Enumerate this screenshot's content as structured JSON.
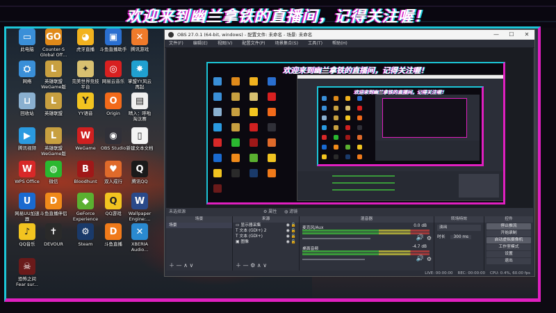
{
  "banner": {
    "text": "欢迎来到幽兰拿铁的直播间，记得关注喔！",
    "colors": {
      "magenta": "#e01fc0",
      "cyan": "#1cc6d8"
    }
  },
  "desktop": {
    "icons": [
      {
        "label": "此电脑",
        "icon": "computer-icon",
        "color": "#3a8fd8",
        "glyph": "▭"
      },
      {
        "label": "Counter-S\nGlobal Off...",
        "icon": "csgo-icon",
        "color": "#e08a1a",
        "glyph": "GO"
      },
      {
        "label": "虎牙直播",
        "icon": "huya-icon",
        "color": "#f2b21e",
        "glyph": "◕"
      },
      {
        "label": "斗鱼直播助手",
        "icon": "douyu-assistant-icon",
        "color": "#2a6fd0",
        "glyph": "▣"
      },
      {
        "label": "腾讯游戏",
        "icon": "tencent-game-icon",
        "color": "#f07a2a",
        "glyph": "✕"
      },
      {
        "label": "网络",
        "icon": "network-icon",
        "color": "#3a8fd8",
        "glyph": "⛭"
      },
      {
        "label": "英雄联盟\nWeGame版",
        "icon": "lol-icon",
        "color": "#c8a040",
        "glyph": "L"
      },
      {
        "label": "完美世界竞技\n平台",
        "icon": "perfect-world-icon",
        "color": "#d8c070",
        "glyph": "✦"
      },
      {
        "label": "网易云音乐",
        "icon": "netease-music-icon",
        "color": "#d82020",
        "glyph": "◎"
      },
      {
        "label": "掌盟YY风云\n再起",
        "icon": "yy-icon",
        "color": "#20a0d0",
        "glyph": "✸"
      },
      {
        "label": "回收站",
        "icon": "recycle-bin-icon",
        "color": "#8ab0d0",
        "glyph": "⊔"
      },
      {
        "label": "英雄联盟",
        "icon": "lol-icon",
        "color": "#c8a040",
        "glyph": "L"
      },
      {
        "label": "YY语音",
        "icon": "yy-voice-icon",
        "color": "#f2c420",
        "glyph": "Y"
      },
      {
        "label": "Origin",
        "icon": "origin-icon",
        "color": "#f26a1a",
        "glyph": "O"
      },
      {
        "label": "晴入：呼啦\n淘汰赛",
        "icon": "game-icon",
        "color": "#f0f0f0",
        "glyph": "▤"
      },
      {
        "label": "腾讯视频",
        "icon": "tencent-video-icon",
        "color": "#2a9ae0",
        "glyph": "▶"
      },
      {
        "label": "英雄联盟\nWeGame版",
        "icon": "lol-icon",
        "color": "#c8a040",
        "glyph": "L"
      },
      {
        "label": "WeGame",
        "icon": "wegame-icon",
        "color": "#d02020",
        "glyph": "W"
      },
      {
        "label": "OBS Studio",
        "icon": "obs-icon",
        "color": "#303038",
        "glyph": "◉"
      },
      {
        "label": "新建文本文档",
        "icon": "text-document-icon",
        "color": "#f4f4f4",
        "glyph": "▯"
      },
      {
        "label": "WPS Office",
        "icon": "wps-icon",
        "color": "#d82828",
        "glyph": "W"
      },
      {
        "label": "微信",
        "icon": "wechat-icon",
        "color": "#2ab830",
        "glyph": "◍"
      },
      {
        "label": "Bloodhunt",
        "icon": "bloodhunt-icon",
        "color": "#a01818",
        "glyph": "B"
      },
      {
        "label": "双人成行",
        "icon": "it-takes-two-icon",
        "color": "#e06a2a",
        "glyph": "♥"
      },
      {
        "label": "腾讯QQ",
        "icon": "qq-icon",
        "color": "#1a1a1a",
        "glyph": "Q"
      },
      {
        "label": "网易UU加速\n器",
        "icon": "uu-icon",
        "color": "#1a6ad0",
        "glyph": "U"
      },
      {
        "label": "斗鱼直播伴侣",
        "icon": "douyu-companion-icon",
        "color": "#f08a1a",
        "glyph": "D"
      },
      {
        "label": "GeForce\nExperience",
        "icon": "geforce-icon",
        "color": "#5ab030",
        "glyph": "◆"
      },
      {
        "label": "QQ游戏",
        "icon": "qq-game-icon",
        "color": "#f2c420",
        "glyph": "Q"
      },
      {
        "label": "Wallpaper\nEngine:...",
        "icon": "wallpaper-engine-icon",
        "color": "#2a4a8a",
        "glyph": "W"
      },
      {
        "label": "QQ音乐",
        "icon": "qq-music-icon",
        "color": "#f2c420",
        "glyph": "♪"
      },
      {
        "label": "DEVOUR",
        "icon": "devour-icon",
        "color": "#2a2a2a",
        "glyph": "✝"
      },
      {
        "label": "Steam",
        "icon": "steam-icon",
        "color": "#1a3a6a",
        "glyph": "⚙"
      },
      {
        "label": "斗鱼直播",
        "icon": "douyu-icon",
        "color": "#f07a1a",
        "glyph": "D"
      },
      {
        "label": "XBERIA\nAudio...",
        "icon": "xberia-icon",
        "color": "#2a8ad0",
        "glyph": "✕"
      },
      {
        "label": "恐怖之间\nFear sur...",
        "icon": "fear-icon",
        "color": "#6a1a1a",
        "glyph": "☠"
      }
    ]
  },
  "obs": {
    "title": "OBS 27.0.1 (64-bit, windows) - 配置文件: 未命名 - 场景: 未命名",
    "menu": [
      "文件(F)",
      "编辑(E)",
      "视图(V)",
      "配置文件(P)",
      "场景集合(S)",
      "工具(T)",
      "帮助(H)"
    ],
    "nested_title": "欢迎来到幽兰拿铁的直播间，记得关注喔！",
    "scene_bar": {
      "label": "未选择源",
      "props": "属性",
      "filters": "滤镜"
    },
    "scenes": {
      "header": "场景",
      "items": [
        "场景"
      ]
    },
    "sources": {
      "header": "来源",
      "items": [
        "显示器采集",
        "文本 (GDI+) 2",
        "文本 (GDI+)",
        "图像"
      ]
    },
    "mixer": {
      "header": "混音器",
      "tracks": [
        {
          "name": "麦克风/Aux",
          "db": "0.0 dB",
          "level": 0.65
        },
        {
          "name": "桌面音频",
          "db": "-4.7 dB",
          "level": 0.6
        }
      ]
    },
    "transitions": {
      "header": "转场特效",
      "type": "淡出",
      "duration_label": "时长",
      "duration": "300 ms"
    },
    "controls": {
      "header": "控件",
      "buttons": [
        "停止推流",
        "开始录制",
        "启动虚拟摄像机",
        "工作室模式",
        "设置",
        "退出"
      ]
    },
    "status": {
      "live": "LIVE: 00:00:00",
      "rec": "REC: 00:00:00",
      "cpu": "CPU: 0.4%, 60.00 fps"
    }
  }
}
